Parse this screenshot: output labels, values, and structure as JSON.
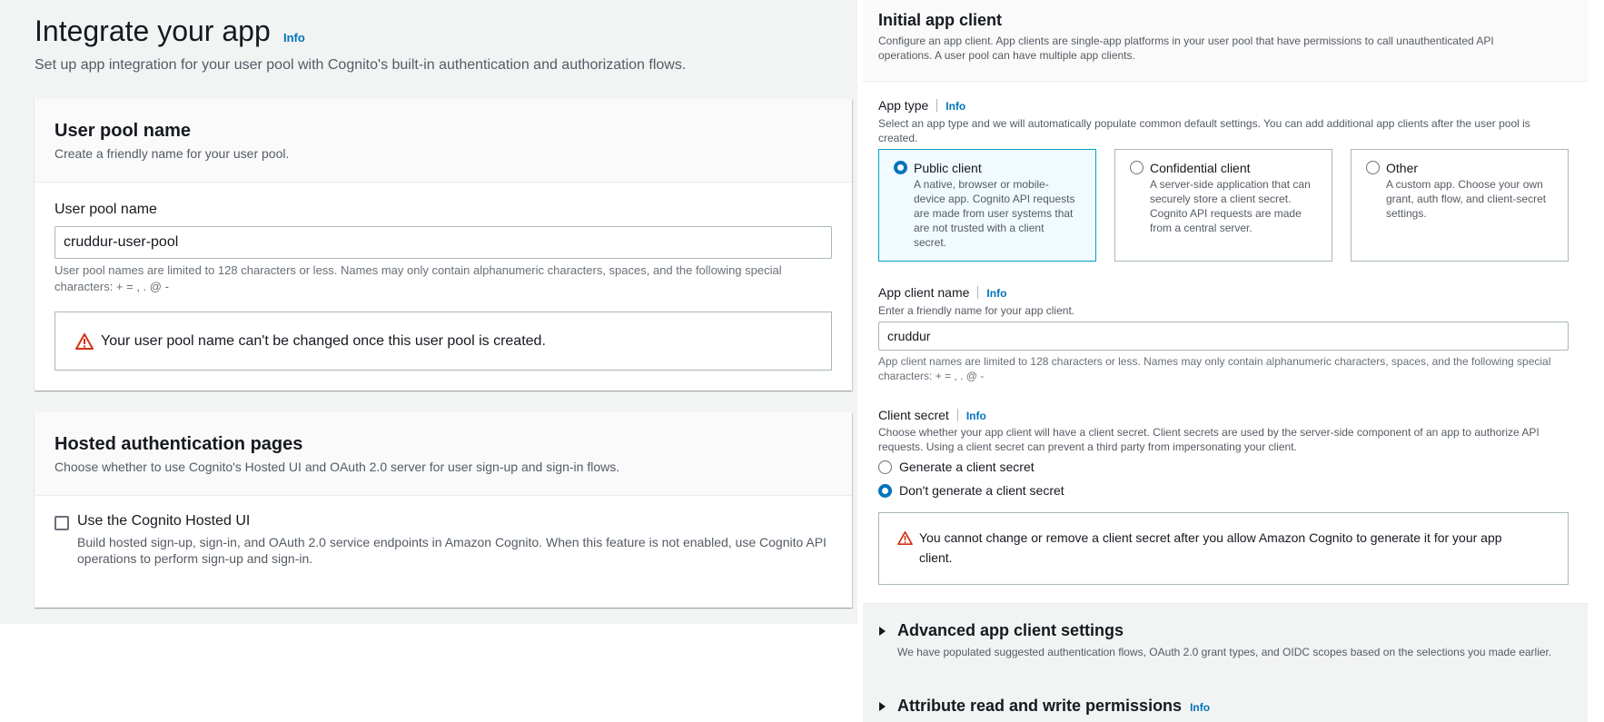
{
  "page": {
    "title": "Integrate your app",
    "info": "Info",
    "description": "Set up app integration for your user pool with Cognito's built-in authentication and authorization flows."
  },
  "user_pool_panel": {
    "title": "User pool name",
    "description": "Create a friendly name for your user pool.",
    "field_label": "User pool name",
    "value": "cruddur-user-pool",
    "hint_line1": "User pool names are limited to 128 characters or less. Names may only contain alphanumeric characters, spaces, and the following special",
    "hint_line2": "characters: + = , . @ -",
    "alert": "Your user pool name can't be changed once this user pool is created."
  },
  "hosted_panel": {
    "title": "Hosted authentication pages",
    "description": "Choose whether to use Cognito's Hosted UI and OAuth 2.0 server for user sign-up and sign-in flows.",
    "checkbox_label": "Use the Cognito Hosted UI",
    "checkbox_checked": false,
    "checkbox_desc_line1": "Build hosted sign-up, sign-in, and OAuth 2.0 service endpoints in Amazon Cognito. When this feature is not enabled, use Cognito API",
    "checkbox_desc_line2": "operations to perform sign-up and sign-in."
  },
  "app_client": {
    "title": "Initial app client",
    "description_line1": "Configure an app client. App clients are single-app platforms in your user pool that have permissions to call unauthenticated API",
    "description_line2": "operations. A user pool can have multiple app clients.",
    "info": "Info",
    "app_type": {
      "label": "App type",
      "hint_line1": "Select an app type and we will automatically populate common default settings. You can add additional app clients after the user pool is",
      "hint_line2": "created.",
      "options": [
        {
          "title": "Public client",
          "selected": true,
          "desc": [
            "A native, browser or mobile-",
            "device app. Cognito API requests",
            "are made from user systems that",
            "are not trusted with a client",
            "secret."
          ]
        },
        {
          "title": "Confidential client",
          "selected": false,
          "desc": [
            "A server-side application that can",
            "securely store a client secret.",
            "Cognito API requests are made",
            "from a central server."
          ]
        },
        {
          "title": "Other",
          "selected": false,
          "desc": [
            "A custom app. Choose your own",
            "grant, auth flow, and client-secret",
            "settings."
          ]
        }
      ]
    },
    "client_name": {
      "label": "App client name",
      "hint": "Enter a friendly name for your app client.",
      "value": "cruddur",
      "rule_line1": "App client names are limited to 128 characters or less. Names may only contain alphanumeric characters, spaces, and the following special",
      "rule_line2": "characters: + = , . @ -"
    },
    "client_secret": {
      "label": "Client secret",
      "hint_line1": "Choose whether your app client will have a client secret. Client secrets are used by the server-side component of an app to authorize API",
      "hint_line2": "requests. Using a client secret can prevent a third party from impersonating your client.",
      "options": [
        {
          "label": "Generate a client secret",
          "selected": false
        },
        {
          "label": "Don't generate a client secret",
          "selected": true
        }
      ],
      "alert_line1": "You cannot change or remove a client secret after you allow Amazon Cognito to generate it for your app",
      "alert_line2": "client."
    }
  },
  "advanced": {
    "title": "Advanced app client settings",
    "description": "We have populated suggested authentication flows, OAuth 2.0 grant types, and OIDC scopes based on the selections you made earlier."
  },
  "attributes": {
    "title": "Attribute read and write permissions",
    "info": "Info"
  },
  "colors": {
    "link": "#0073bb",
    "selected_border": "#00a1c9",
    "warning": "#d13212",
    "background": "#f2f3f3"
  }
}
